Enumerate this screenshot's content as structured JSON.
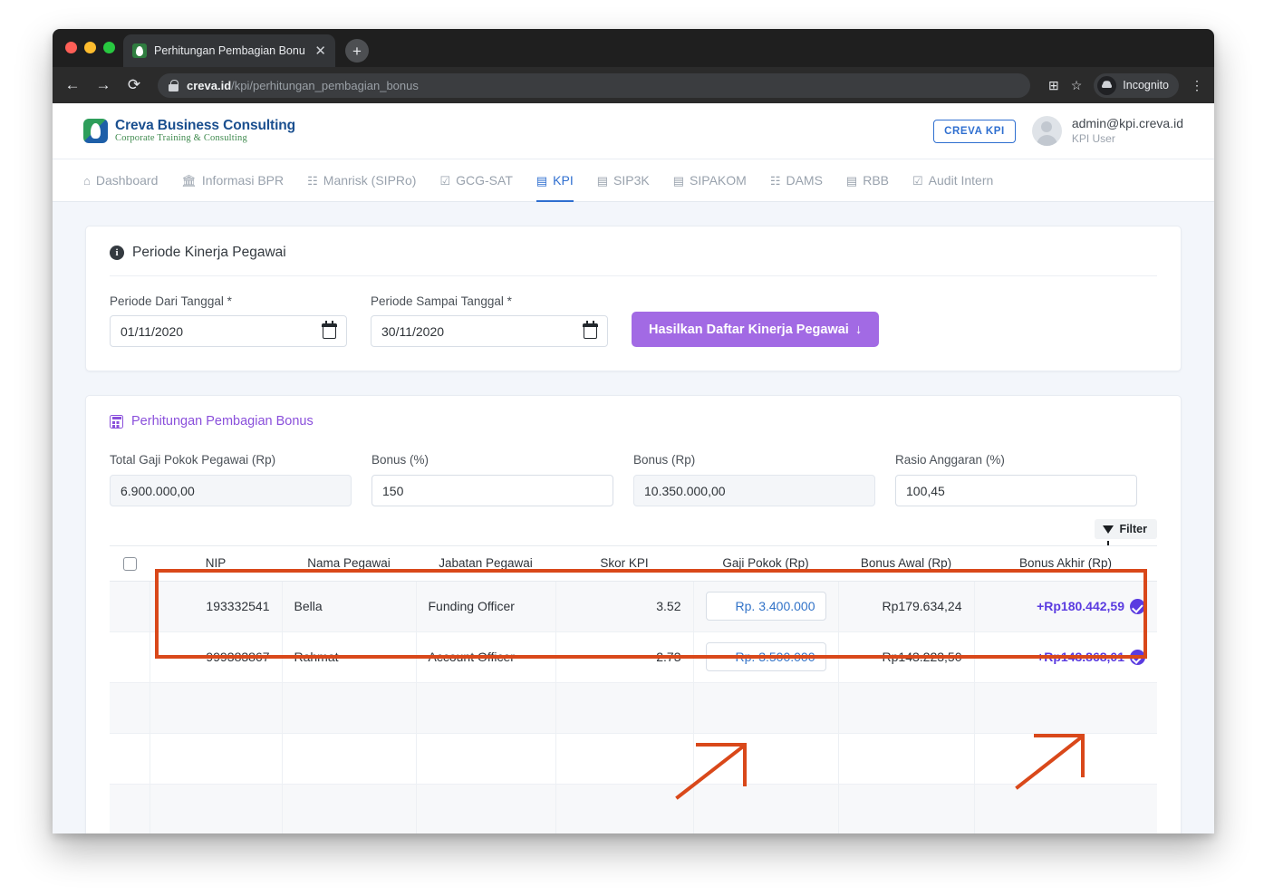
{
  "browser": {
    "tab_title": "Perhitungan Pembagian Bonus",
    "close_label": "✕",
    "newtab_label": "+",
    "back_icon": "←",
    "forward_icon": "→",
    "reload_icon": "⟳",
    "url_domain": "creva.id",
    "url_path": "/kpi/perhitungan_pembagian_bonus",
    "translate_icon": "⊞",
    "star_icon": "☆",
    "incognito_label": "Incognito",
    "menu_icon": "⋮"
  },
  "header": {
    "brand_title": "Creva Business Consulting",
    "brand_subtitle": "Corporate Training & Consulting",
    "kpi_badge": "CREVA KPI",
    "user_email": "admin@kpi.creva.id",
    "user_role": "KPI User"
  },
  "nav": {
    "items": [
      {
        "label": "Dashboard",
        "icon": "⌂",
        "active": false
      },
      {
        "label": "Informasi BPR",
        "icon": "🏛",
        "active": false
      },
      {
        "label": "Manrisk (SIPRo)",
        "icon": "☷",
        "active": false
      },
      {
        "label": "GCG-SAT",
        "icon": "☑",
        "active": false
      },
      {
        "label": "KPI",
        "icon": "▤",
        "active": true
      },
      {
        "label": "SIP3K",
        "icon": "▤",
        "active": false
      },
      {
        "label": "SIPAKOM",
        "icon": "▤",
        "active": false
      },
      {
        "label": "DAMS",
        "icon": "☷",
        "active": false
      },
      {
        "label": "RBB",
        "icon": "▤",
        "active": false
      },
      {
        "label": "Audit Intern",
        "icon": "☑",
        "active": false
      }
    ]
  },
  "period_card": {
    "title": "Periode Kinerja Pegawai",
    "info_icon": "i",
    "from_label": "Periode Dari Tanggal *",
    "from_value": "01/11/2020",
    "to_label": "Periode Sampai Tanggal *",
    "to_value": "30/11/2020",
    "generate_button": "Hasilkan Daftar Kinerja Pegawai",
    "generate_button_icon": "↓"
  },
  "bonus_card": {
    "title": "Perhitungan Pembagian Bonus",
    "fields": [
      {
        "label": "Total Gaji Pokok Pegawai (Rp)",
        "value": "6.900.000,00",
        "readonly": true
      },
      {
        "label": "Bonus (%)",
        "value": "150",
        "readonly": false
      },
      {
        "label": "Bonus (Rp)",
        "value": "10.350.000,00",
        "readonly": true
      },
      {
        "label": "Rasio Anggaran (%)",
        "value": "100,45",
        "readonly": false
      }
    ],
    "filter_button": "Filter"
  },
  "table": {
    "columns": [
      "",
      "NIP",
      "Nama Pegawai",
      "Jabatan Pegawai",
      "Skor KPI",
      "Gaji Pokok (Rp)",
      "Bonus Awal (Rp)",
      "Bonus Akhir (Rp)"
    ],
    "rows": [
      {
        "nip": "193332541",
        "nama": "Bella",
        "jabatan": "Funding Officer",
        "skor": "3.52",
        "gaji": "Rp. 3.400.000",
        "bonus_awal": "Rp179.634,24",
        "bonus_akhir": "+Rp180.442,59"
      },
      {
        "nip": "999383867",
        "nama": "Rahmat",
        "jabatan": "Account Officer",
        "skor": "2.73",
        "gaji": "Rp. 3.500.000",
        "bonus_awal": "Rp143.223,50",
        "bonus_akhir": "+Rp143.868,01"
      }
    ],
    "empty_rows": 4
  },
  "colors": {
    "accent_purple": "#8a4fdb",
    "button_purple": "#a26ae4",
    "bonus_purple": "#5a3be0",
    "link_blue": "#3273c8",
    "nav_active": "#2f6fd0",
    "annotation_orange": "#d9481a"
  }
}
